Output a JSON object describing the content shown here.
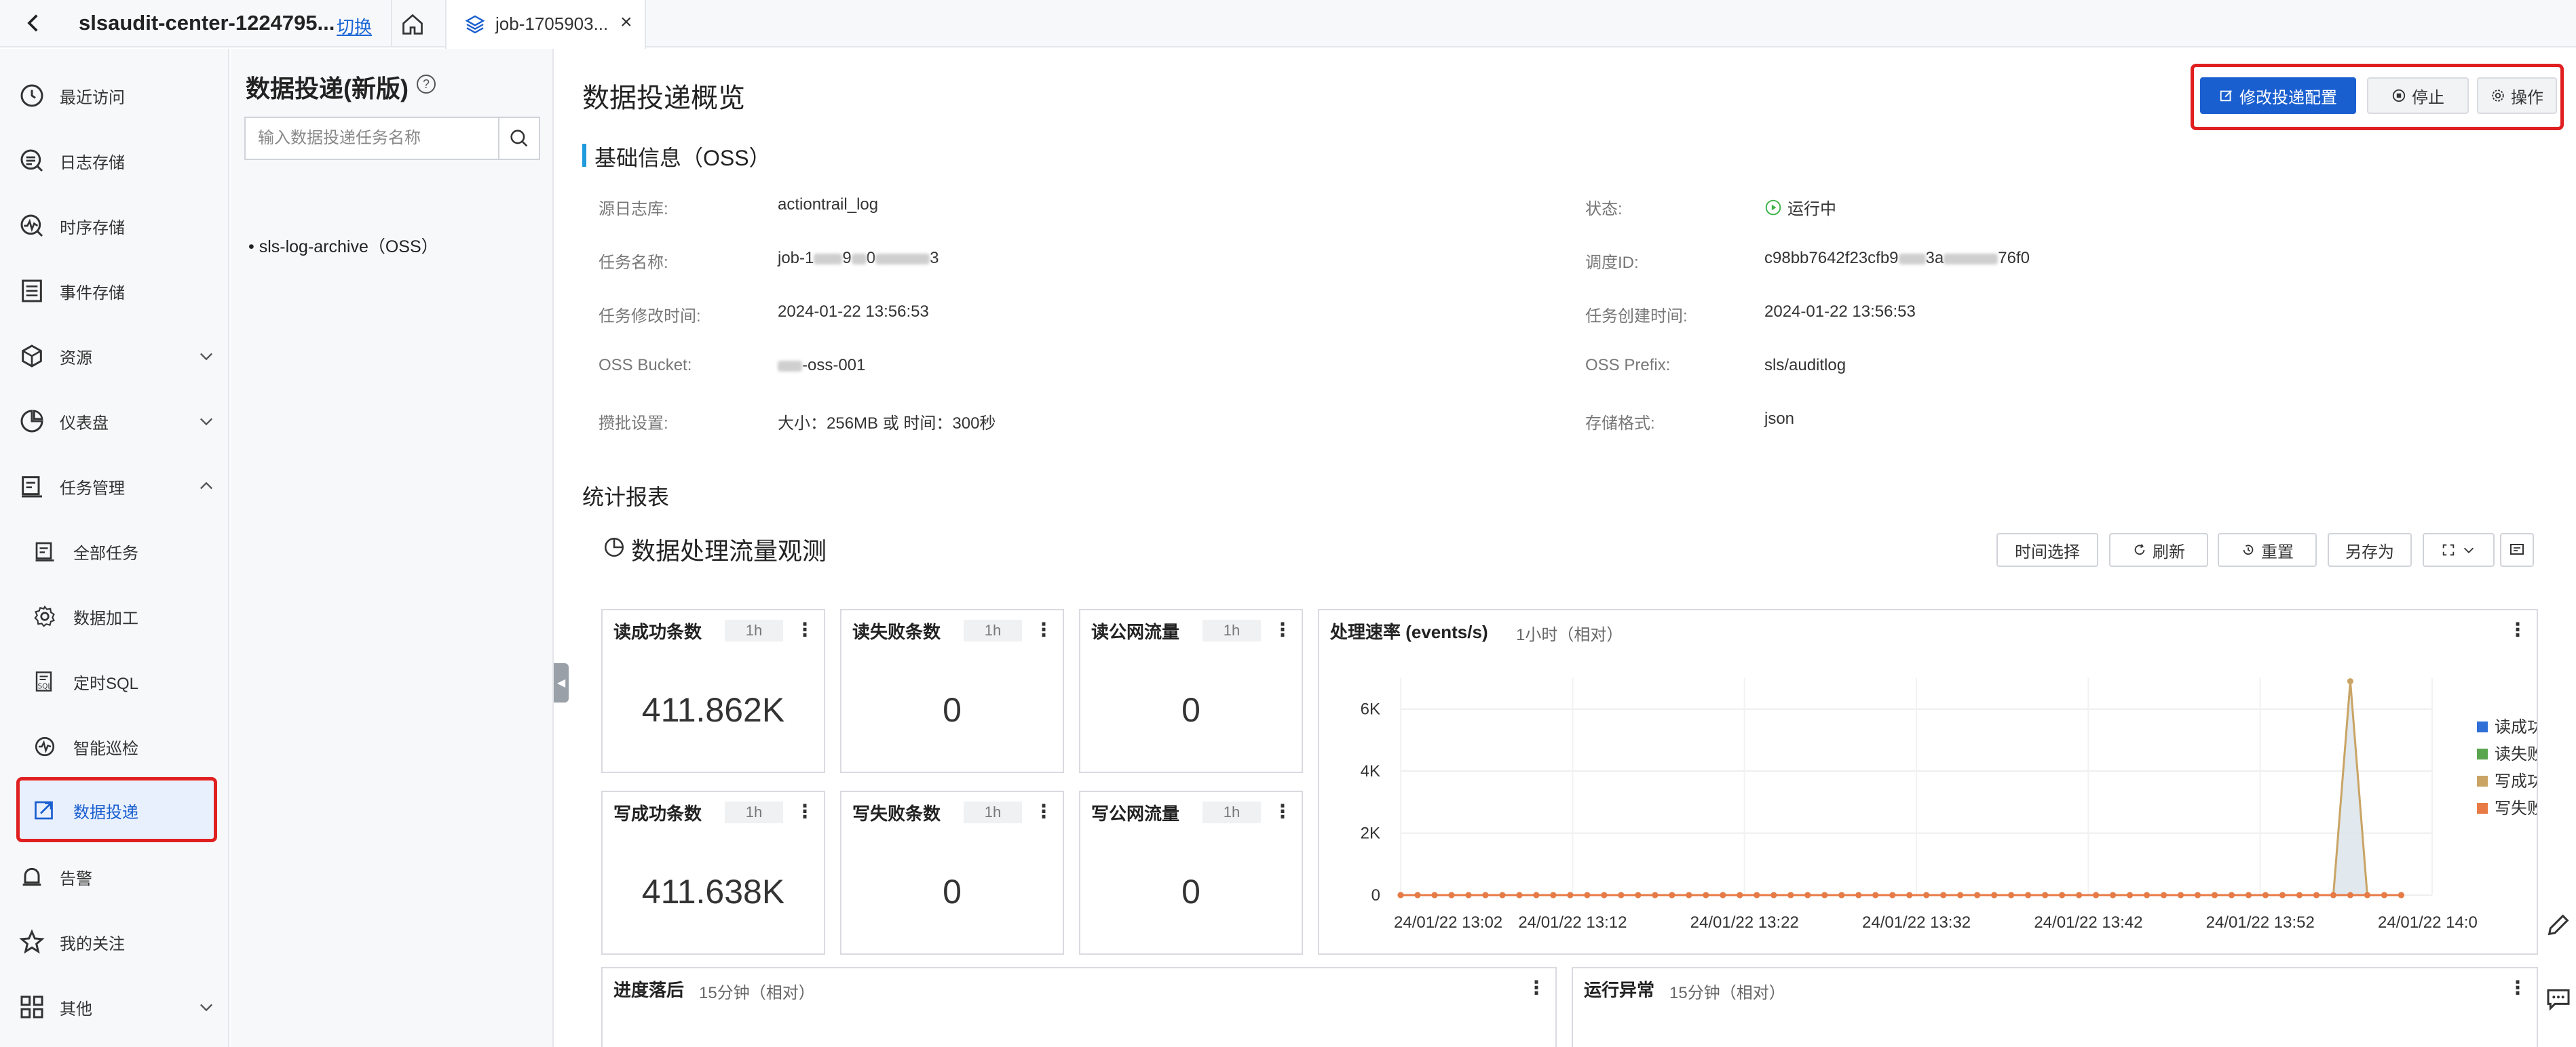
{
  "tabbar": {
    "project": "slsaudit-center-1224795...",
    "switch_label": "切换",
    "active_tab": "job-1705903..."
  },
  "leftnav": {
    "items": [
      {
        "label": "最近访问",
        "icon": "clock-icon"
      },
      {
        "label": "日志存储",
        "icon": "log-store-icon"
      },
      {
        "label": "时序存储",
        "icon": "metric-store-icon"
      },
      {
        "label": "事件存储",
        "icon": "event-store-icon"
      },
      {
        "label": "资源",
        "icon": "cube-icon"
      },
      {
        "label": "仪表盘",
        "icon": "dashboard-icon"
      },
      {
        "label": "任务管理",
        "icon": "task-icon"
      },
      {
        "label": "全部任务",
        "icon": "all-tasks-icon"
      },
      {
        "label": "数据加工",
        "icon": "gear-icon"
      },
      {
        "label": "定时SQL",
        "icon": "sql-icon"
      },
      {
        "label": "智能巡检",
        "icon": "inspect-icon"
      },
      {
        "label": "数据投递",
        "icon": "delivery-icon"
      },
      {
        "label": "告警",
        "icon": "bell-icon"
      },
      {
        "label": "我的关注",
        "icon": "star-icon"
      },
      {
        "label": "其他",
        "icon": "grid-icon"
      }
    ]
  },
  "col2": {
    "title": "数据投递(新版)",
    "help": "?",
    "search_placeholder": "输入数据投递任务名称",
    "job_item": "• sls-log-archive（OSS）"
  },
  "main": {
    "title": "数据投递概览",
    "btn_modify": "修改投递配置",
    "btn_stop": "停止",
    "btn_ops": "操作",
    "section_basic": "基础信息（OSS）",
    "info": {
      "source_logstore_label": "源日志库:",
      "source_logstore_value": "actiontrail_log",
      "status_label": "状态:",
      "status_value": "运行中",
      "job_name_label": "任务名称:",
      "job_name_prefix": "job-1",
      "job_name_mid": "9",
      "job_name_mid2": "0",
      "job_name_suffix": "3",
      "schedule_id_label": "调度ID:",
      "schedule_id_prefix": "c98bb7642f23cfb9",
      "schedule_id_mid": "3a",
      "schedule_id_suffix": "76f0",
      "modify_time_label": "任务修改时间:",
      "modify_time_value": "2024-01-22 13:56:53",
      "create_time_label": "任务创建时间:",
      "create_time_value": "2024-01-22 13:56:53",
      "bucket_label": "OSS Bucket:",
      "bucket_suffix": "-oss-001",
      "prefix_label": "OSS Prefix:",
      "prefix_value": "sls/auditlog",
      "batch_label": "攒批设置:",
      "batch_value": "大小：256MB 或 时间：300秒",
      "format_label": "存储格式:",
      "format_value": "json"
    },
    "section_stats": "统计报表",
    "dashboard_title": "数据处理流量观测",
    "toolbar": {
      "time_select": "时间选择",
      "refresh": "刷新",
      "reset": "重置",
      "save_as": "另存为"
    },
    "cards": [
      {
        "title": "读成功条数",
        "badge": "1h",
        "value": "411.862K"
      },
      {
        "title": "读失败条数",
        "badge": "1h",
        "value": "0"
      },
      {
        "title": "读公网流量",
        "badge": "1h",
        "value": "0"
      },
      {
        "title": "写成功条数",
        "badge": "1h",
        "value": "411.638K"
      },
      {
        "title": "写失败条数",
        "badge": "1h",
        "value": "0"
      },
      {
        "title": "写公网流量",
        "badge": "1h",
        "value": "0"
      }
    ],
    "bottom_cards": [
      {
        "title": "进度落后",
        "relative": "15分钟（相对）"
      },
      {
        "title": "运行异常",
        "relative": "15分钟（相对）"
      }
    ]
  },
  "chart_data": {
    "type": "line",
    "title": "处理速率 (events/s)",
    "subtitle": "1小时（相对）",
    "yticks": [
      "0",
      "2K",
      "4K",
      "6K"
    ],
    "ylim": [
      0,
      7000
    ],
    "xticks": [
      "24/01/22 13:02",
      "24/01/22 13:12",
      "24/01/22 13:22",
      "24/01/22 13:32",
      "24/01/22 13:42",
      "24/01/22 13:52",
      "24/01/22 14:0"
    ],
    "grid": true,
    "legend_position": "right",
    "point_count": 60,
    "series": [
      {
        "name": "读成功",
        "color": "#2f6fd6",
        "spike_index": 56,
        "spike_value": 0
      },
      {
        "name": "读失败",
        "color": "#5aa64e",
        "spike_index": 56,
        "spike_value": 0
      },
      {
        "name": "写成功",
        "color": "#c9a465",
        "spike_index": 56,
        "spike_value": 6900
      },
      {
        "name": "写失败",
        "color": "#e87a45",
        "spike_index": 56,
        "spike_value": 0
      }
    ]
  }
}
